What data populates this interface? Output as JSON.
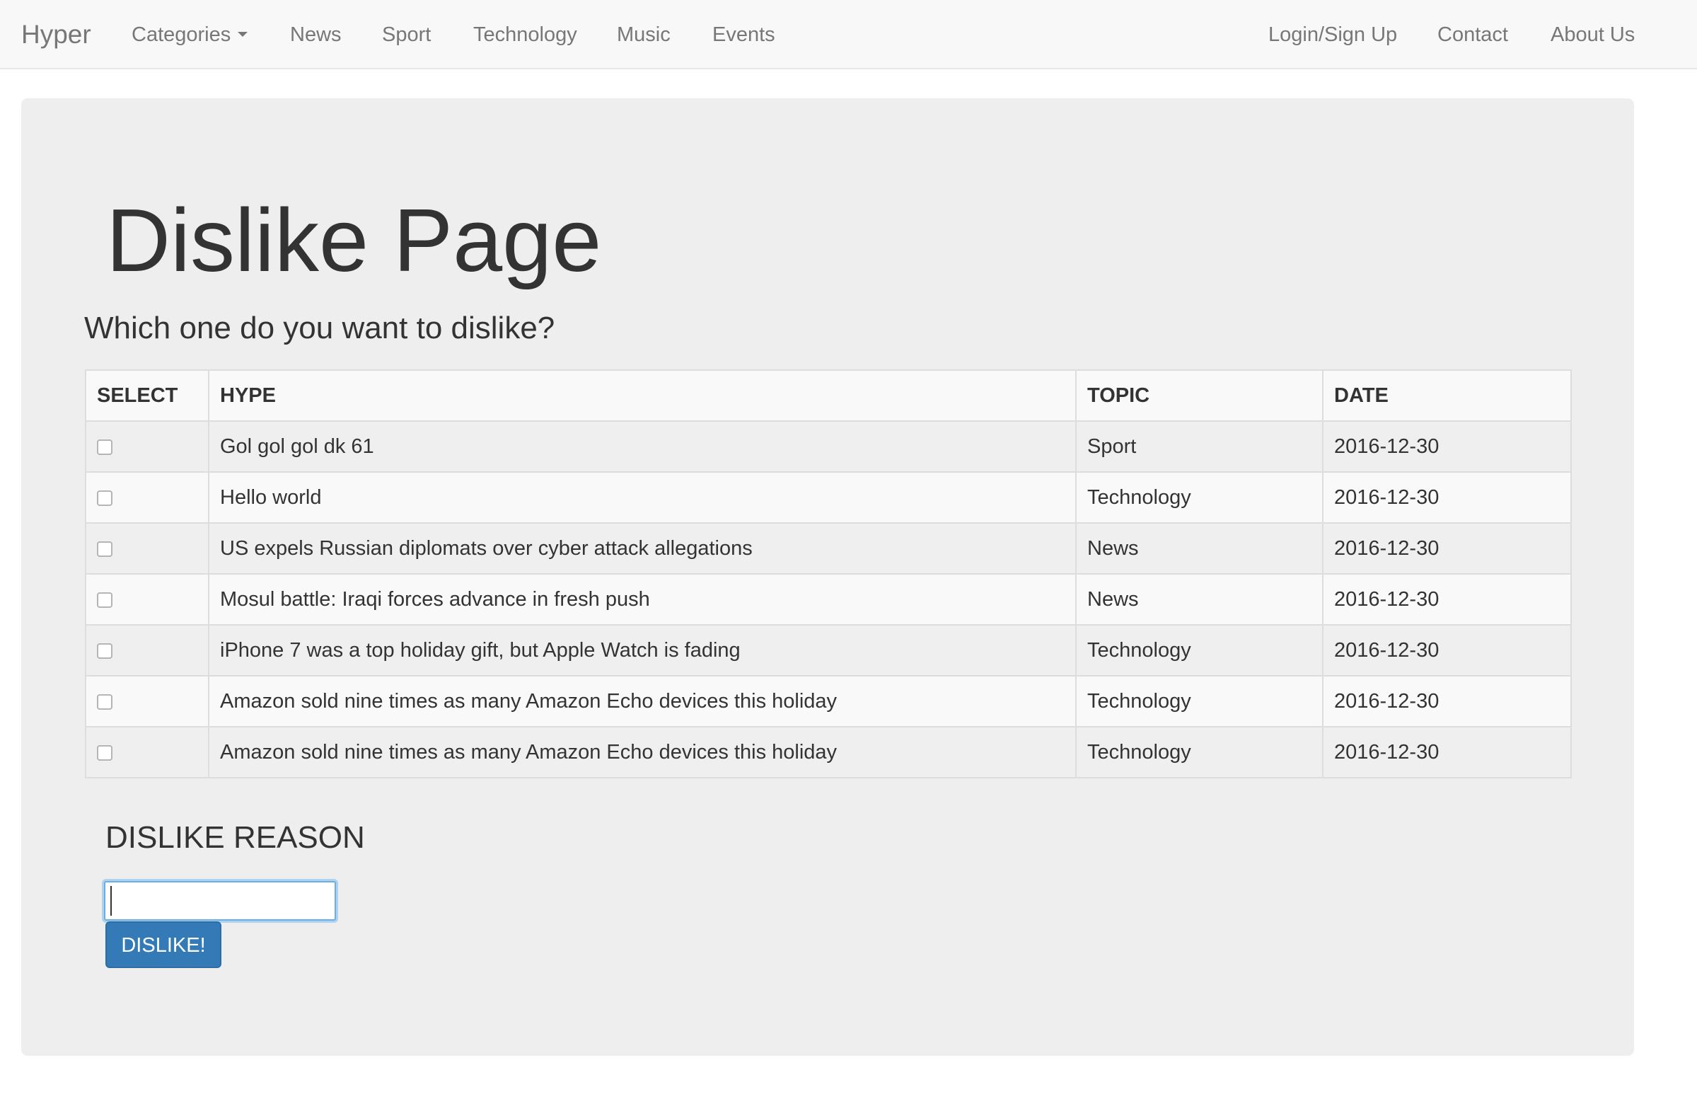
{
  "navbar": {
    "brand": "Hyper",
    "left_items": [
      {
        "label": "Categories",
        "has_dropdown": true
      },
      {
        "label": "News"
      },
      {
        "label": "Sport"
      },
      {
        "label": "Technology"
      },
      {
        "label": "Music"
      },
      {
        "label": "Events"
      }
    ],
    "right_items": [
      {
        "label": "Login/Sign Up"
      },
      {
        "label": "Contact"
      },
      {
        "label": "About Us"
      }
    ]
  },
  "main": {
    "title": "Dislike Page",
    "subtitle": "Which one do you want to dislike?",
    "table": {
      "headers": [
        "SELECT",
        "HYPE",
        "TOPIC",
        "DATE"
      ],
      "rows": [
        {
          "checked": false,
          "hype": "Gol gol gol dk 61",
          "topic": "Sport",
          "date": "2016-12-30"
        },
        {
          "checked": false,
          "hype": "Hello world",
          "topic": "Technology",
          "date": "2016-12-30"
        },
        {
          "checked": false,
          "hype": "US expels Russian diplomats over cyber attack allegations",
          "topic": "News",
          "date": "2016-12-30"
        },
        {
          "checked": false,
          "hype": "Mosul battle: Iraqi forces advance in fresh push",
          "topic": "News",
          "date": "2016-12-30"
        },
        {
          "checked": false,
          "hype": "iPhone 7 was a top holiday gift, but Apple Watch is fading",
          "topic": "Technology",
          "date": "2016-12-30"
        },
        {
          "checked": false,
          "hype": "Amazon sold nine times as many Amazon Echo devices this holiday",
          "topic": "Technology",
          "date": "2016-12-30"
        },
        {
          "checked": false,
          "hype": "Amazon sold nine times as many Amazon Echo devices this holiday",
          "topic": "Technology",
          "date": "2016-12-30"
        }
      ]
    },
    "form": {
      "reason_label": "DISLIKE REASON",
      "reason_value": "",
      "submit_label": "DISLIKE!"
    }
  },
  "colors": {
    "navbar_bg": "#f8f8f8",
    "jumbotron_bg": "#eeeeee",
    "primary_button": "#337ab7",
    "input_focus": "#66afe9"
  }
}
